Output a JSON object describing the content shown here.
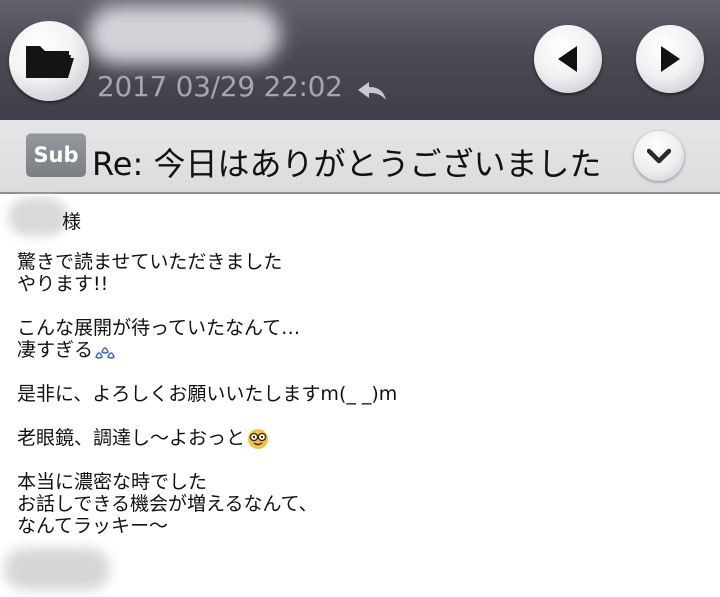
{
  "header": {
    "datetime": "2017 03/29 22:02",
    "icons": {
      "folder": "folder-icon",
      "reply": "reply-arrow-icon",
      "prev": "triangle-left-icon",
      "next": "triangle-right-icon"
    }
  },
  "subject": {
    "badge": "Sub",
    "text": "Re: 今日はありがとうございました",
    "expand_icon": "chevron-down-icon"
  },
  "message": {
    "salutation_suffix": "様",
    "lines": [
      "驚きで読ませていただきました",
      "やります!!",
      "",
      "こんな展開が待っていたなんて…",
      "凄すぎる",
      "",
      "是非に、よろしくお願いいたしますm(_ _)m",
      "",
      "老眼鏡、調達し〜よおっと",
      "",
      "本当に濃密な時でした",
      "お話しできる機会が増えるなんて、",
      "なんてラッキー〜"
    ],
    "emoji_icons": [
      "sweat-drops-icon",
      "glasses-face-icon"
    ]
  },
  "colors": {
    "header_bg": "#4a4954",
    "subject_bar_bg": "#e3e3e6",
    "badge_bg": "#84898e",
    "text": "#111111"
  }
}
